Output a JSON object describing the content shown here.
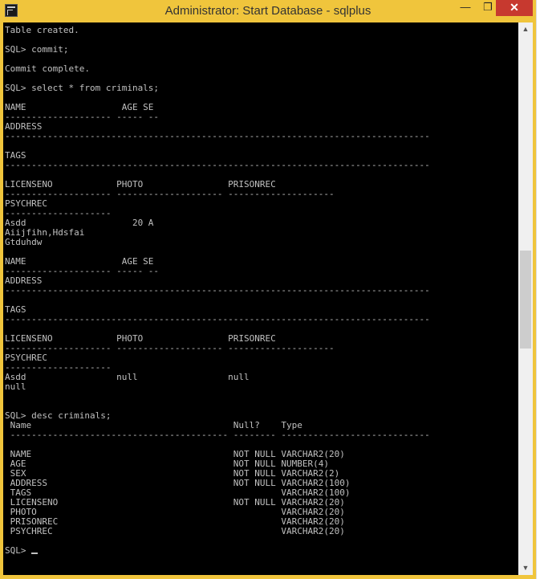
{
  "window": {
    "title": "Administrator: Start Database - sqlplus",
    "controls": {
      "minimize": "—",
      "maximize": "❐",
      "close": "✕"
    }
  },
  "console": {
    "lines": [
      "Table created.",
      "",
      "SQL> commit;",
      "",
      "Commit complete.",
      "",
      "SQL> select * from criminals;",
      "",
      "NAME                  AGE SE",
      "-------------------- ----- --",
      "ADDRESS",
      "--------------------------------------------------------------------------------",
      "",
      "TAGS",
      "--------------------------------------------------------------------------------",
      "",
      "LICENSENO            PHOTO                PRISONREC",
      "-------------------- -------------------- --------------------",
      "PSYCHREC",
      "--------------------",
      "Asdd                    20 A",
      "Aiijfihn,Hdsfai",
      "Gtduhdw",
      "",
      "NAME                  AGE SE",
      "-------------------- ----- --",
      "ADDRESS",
      "--------------------------------------------------------------------------------",
      "",
      "TAGS",
      "--------------------------------------------------------------------------------",
      "",
      "LICENSENO            PHOTO                PRISONREC",
      "-------------------- -------------------- --------------------",
      "PSYCHREC",
      "--------------------",
      "Asdd                 null                 null",
      "null",
      "",
      "",
      "SQL> desc criminals;",
      " Name                                      Null?    Type",
      " ----------------------------------------- -------- ----------------------------",
      "",
      " NAME                                      NOT NULL VARCHAR2(20)",
      " AGE                                       NOT NULL NUMBER(4)",
      " SEX                                       NOT NULL VARCHAR2(2)",
      " ADDRESS                                   NOT NULL VARCHAR2(100)",
      " TAGS                                               VARCHAR2(100)",
      " LICENSENO                                 NOT NULL VARCHAR2(20)",
      " PHOTO                                              VARCHAR2(20)",
      " PRISONREC                                          VARCHAR2(20)",
      " PSYCHREC                                           VARCHAR2(20)",
      "",
      "SQL> "
    ]
  },
  "scrollbar": {
    "up": "▲",
    "down": "▼"
  },
  "colors": {
    "accent": "#f0c53c",
    "close": "#c7392f",
    "console_bg": "#000000",
    "console_fg": "#c0c0c0"
  }
}
